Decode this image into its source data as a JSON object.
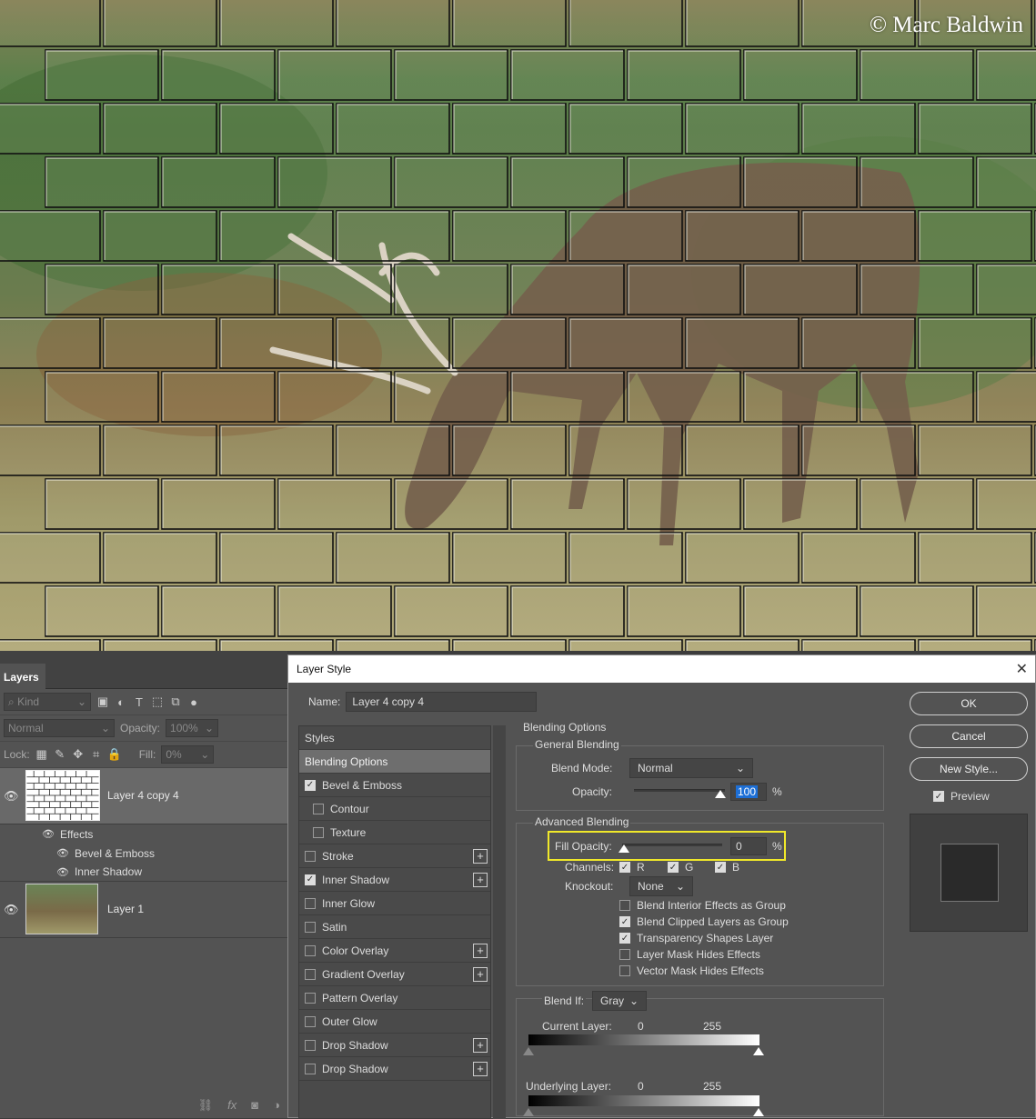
{
  "canvas": {
    "watermark": "© Marc Baldwin"
  },
  "layers_panel": {
    "tab": "Layers",
    "filter_kind": "Kind",
    "blend_mode": "Normal",
    "opacity_label": "Opacity:",
    "opacity_value": "100%",
    "lock_label": "Lock:",
    "fill_label": "Fill:",
    "fill_value": "0%",
    "layers": [
      {
        "name": "Layer 4 copy 4",
        "selected": true
      },
      {
        "name": "Layer 1",
        "selected": false
      }
    ],
    "effects_label": "Effects",
    "effects": [
      "Bevel & Emboss",
      "Inner Shadow"
    ],
    "bottom_icons": [
      "link-icon",
      "fx-icon",
      "mask-icon",
      "adjustment-icon"
    ]
  },
  "dialog": {
    "title": "Layer Style",
    "name_label": "Name:",
    "name_value": "Layer 4 copy 4",
    "styles_header": "Styles",
    "styles": [
      {
        "label": "Blending Options",
        "selected": true,
        "checkbox": false,
        "checked": false,
        "plus": false,
        "indent": false
      },
      {
        "label": "Bevel & Emboss",
        "checkbox": true,
        "checked": true,
        "plus": false,
        "indent": false
      },
      {
        "label": "Contour",
        "checkbox": true,
        "checked": false,
        "plus": false,
        "indent": true
      },
      {
        "label": "Texture",
        "checkbox": true,
        "checked": false,
        "plus": false,
        "indent": true
      },
      {
        "label": "Stroke",
        "checkbox": true,
        "checked": false,
        "plus": true,
        "indent": false
      },
      {
        "label": "Inner Shadow",
        "checkbox": true,
        "checked": true,
        "plus": true,
        "indent": false
      },
      {
        "label": "Inner Glow",
        "checkbox": true,
        "checked": false,
        "plus": false,
        "indent": false
      },
      {
        "label": "Satin",
        "checkbox": true,
        "checked": false,
        "plus": false,
        "indent": false
      },
      {
        "label": "Color Overlay",
        "checkbox": true,
        "checked": false,
        "plus": true,
        "indent": false
      },
      {
        "label": "Gradient Overlay",
        "checkbox": true,
        "checked": false,
        "plus": true,
        "indent": false
      },
      {
        "label": "Pattern Overlay",
        "checkbox": true,
        "checked": false,
        "plus": false,
        "indent": false
      },
      {
        "label": "Outer Glow",
        "checkbox": true,
        "checked": false,
        "plus": false,
        "indent": false
      },
      {
        "label": "Drop Shadow",
        "checkbox": true,
        "checked": false,
        "plus": true,
        "indent": false
      },
      {
        "label": "Drop Shadow",
        "checkbox": true,
        "checked": false,
        "plus": true,
        "indent": false
      }
    ],
    "blending": {
      "title": "Blending Options",
      "general_title": "General Blending",
      "blend_mode_label": "Blend Mode:",
      "blend_mode_value": "Normal",
      "opacity_label": "Opacity:",
      "opacity_value": "100",
      "percent": "%",
      "advanced_title": "Advanced Blending",
      "fill_opacity_label": "Fill Opacity:",
      "fill_opacity_value": "0",
      "channels_label": "Channels:",
      "channels": [
        {
          "label": "R",
          "checked": true
        },
        {
          "label": "G",
          "checked": true
        },
        {
          "label": "B",
          "checked": true
        }
      ],
      "knockout_label": "Knockout:",
      "knockout_value": "None",
      "options": [
        {
          "label": "Blend Interior Effects as Group",
          "checked": false
        },
        {
          "label": "Blend Clipped Layers as Group",
          "checked": true
        },
        {
          "label": "Transparency Shapes Layer",
          "checked": true
        },
        {
          "label": "Layer Mask Hides Effects",
          "checked": false
        },
        {
          "label": "Vector Mask Hides Effects",
          "checked": false
        }
      ],
      "blend_if_label": "Blend If:",
      "blend_if_value": "Gray",
      "current_layer_label": "Current Layer:",
      "underlying_layer_label": "Underlying Layer:",
      "range_min": "0",
      "range_max": "255"
    },
    "buttons": {
      "ok": "OK",
      "cancel": "Cancel",
      "new_style": "New Style...",
      "preview": "Preview"
    }
  },
  "colors": {
    "highlight": "#f0e82a",
    "accent": "#1d6fd6",
    "panel": "#535353"
  }
}
